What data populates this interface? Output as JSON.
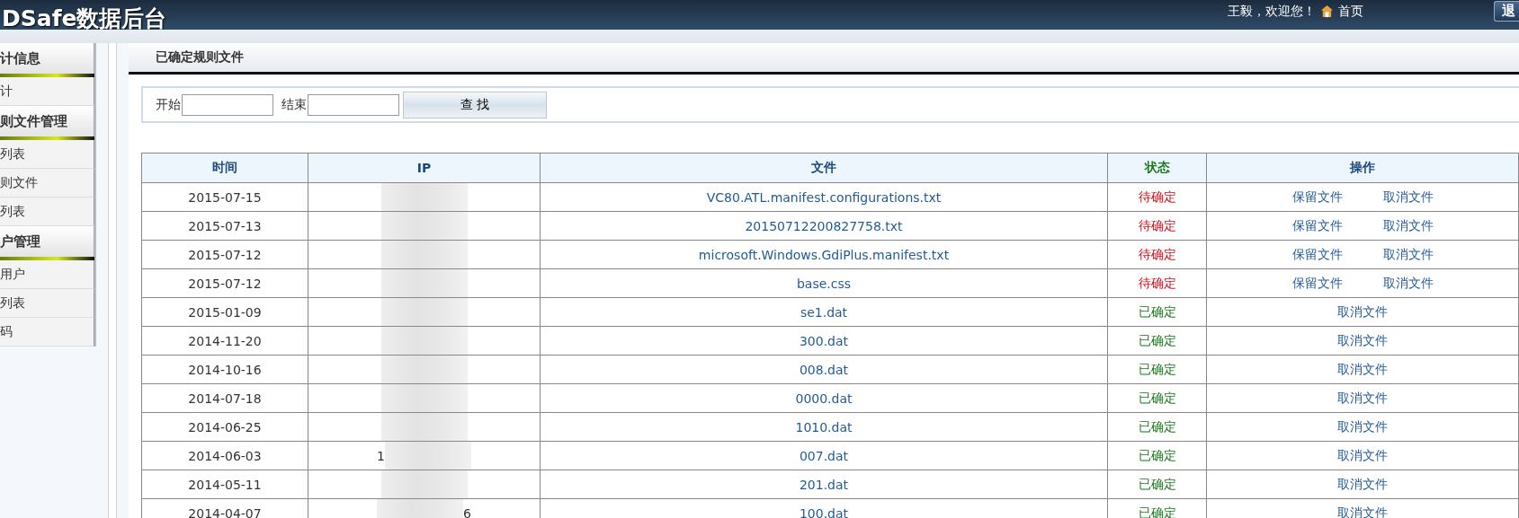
{
  "header": {
    "logo": "DSafe数据后台",
    "greeting": "王毅，欢迎您！",
    "home_link": "首页",
    "logout_button": "退"
  },
  "sidebar": {
    "groups": [
      {
        "title": "计信息",
        "items": [
          "计"
        ]
      },
      {
        "title": "则文件管理",
        "items": [
          "列表",
          "则文件",
          "列表"
        ]
      },
      {
        "title": "户管理",
        "items": [
          "用户",
          "列表",
          "码"
        ]
      }
    ]
  },
  "panel": {
    "title": "已确定规则文件"
  },
  "search": {
    "start_label": "开始",
    "end_label": "结束",
    "button": "查 找"
  },
  "table": {
    "columns": [
      "时间",
      "IP",
      "文件",
      "状态",
      "操作"
    ],
    "rows": [
      {
        "time": "2015-07-15",
        "file": "VC80.ATL.manifest.configurations.txt",
        "status": {
          "text": "待确定",
          "kind": "pending"
        },
        "actions": [
          "保留文件",
          "取消文件"
        ]
      },
      {
        "time": "2015-07-13",
        "file": "20150712200827758.txt",
        "status": {
          "text": "待确定",
          "kind": "pending"
        },
        "actions": [
          "保留文件",
          "取消文件"
        ]
      },
      {
        "time": "2015-07-12",
        "file": "microsoft.Windows.GdiPlus.manifest.txt",
        "status": {
          "text": "待确定",
          "kind": "pending"
        },
        "actions": [
          "保留文件",
          "取消文件"
        ]
      },
      {
        "time": "2015-07-12",
        "file": "base.css",
        "status": {
          "text": "待确定",
          "kind": "pending"
        },
        "actions": [
          "保留文件",
          "取消文件"
        ]
      },
      {
        "time": "2015-01-09",
        "file": "se1.dat",
        "status": {
          "text": "已确定",
          "kind": "confirmed"
        },
        "actions": [
          "取消文件"
        ]
      },
      {
        "time": "2014-11-20",
        "file": "300.dat",
        "status": {
          "text": "已确定",
          "kind": "confirmed"
        },
        "actions": [
          "取消文件"
        ]
      },
      {
        "time": "2014-10-16",
        "file": "008.dat",
        "status": {
          "text": "已确定",
          "kind": "confirmed"
        },
        "actions": [
          "取消文件"
        ]
      },
      {
        "time": "2014-07-18",
        "file": "0000.dat",
        "status": {
          "text": "已确定",
          "kind": "confirmed"
        },
        "actions": [
          "取消文件"
        ]
      },
      {
        "time": "2014-06-25",
        "file": "1010.dat",
        "status": {
          "text": "已确定",
          "kind": "confirmed"
        },
        "actions": [
          "取消文件"
        ]
      },
      {
        "time": "2014-06-03",
        "ip_before": "1",
        "file": "007.dat",
        "status": {
          "text": "已确定",
          "kind": "confirmed"
        },
        "actions": [
          "取消文件"
        ]
      },
      {
        "time": "2014-05-11",
        "file": "201.dat",
        "status": {
          "text": "已确定",
          "kind": "confirmed"
        },
        "actions": [
          "取消文件"
        ]
      },
      {
        "time": "2014-04-07",
        "ip_after": "6",
        "file": "100.dat",
        "status": {
          "text": "已确定",
          "kind": "confirmed"
        },
        "actions": [
          "取消文件"
        ]
      }
    ]
  }
}
